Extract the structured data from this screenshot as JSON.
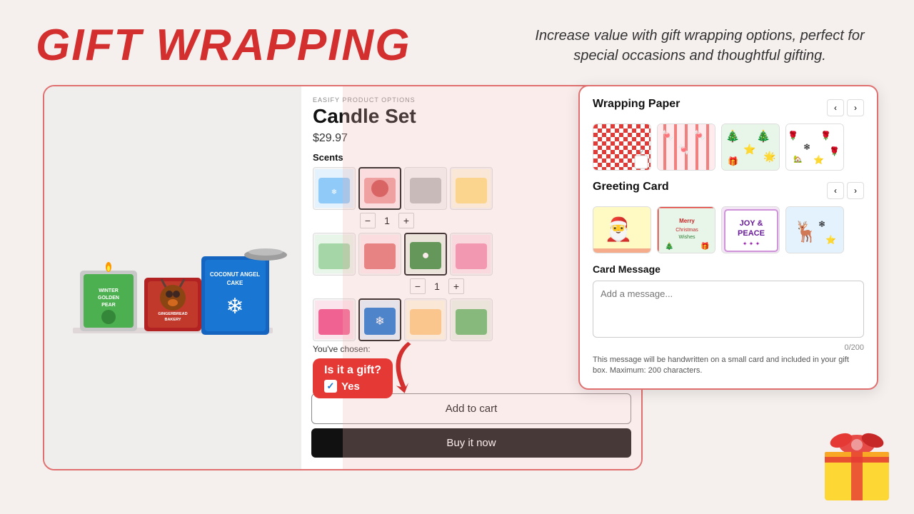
{
  "header": {
    "title": "GIFT WRAPPING",
    "description": "Increase value with gift wrapping options, perfect for special occasions and thoughtful gifting."
  },
  "product": {
    "easify_label": "EASIFY PRODUCT OPTIONS",
    "title": "Candle Set",
    "price": "$29.97",
    "scents_label": "Scents",
    "quantity": "1",
    "chosen_label": "You've chosen:",
    "gift_question": "Is it a gift?",
    "gift_yes": "Yes"
  },
  "buttons": {
    "add_to_cart": "Add to cart",
    "buy_now": "Buy it now"
  },
  "gift_panel": {
    "wrapping_paper_label": "Wrapping Paper",
    "greeting_card_label": "Greeting Card",
    "card_message_label": "Card Message",
    "card_message_placeholder": "Add a message...",
    "char_count": "0/200",
    "card_note": "This message will be handwritten on a small card and included in your gift box. Maximum: 200 characters."
  }
}
